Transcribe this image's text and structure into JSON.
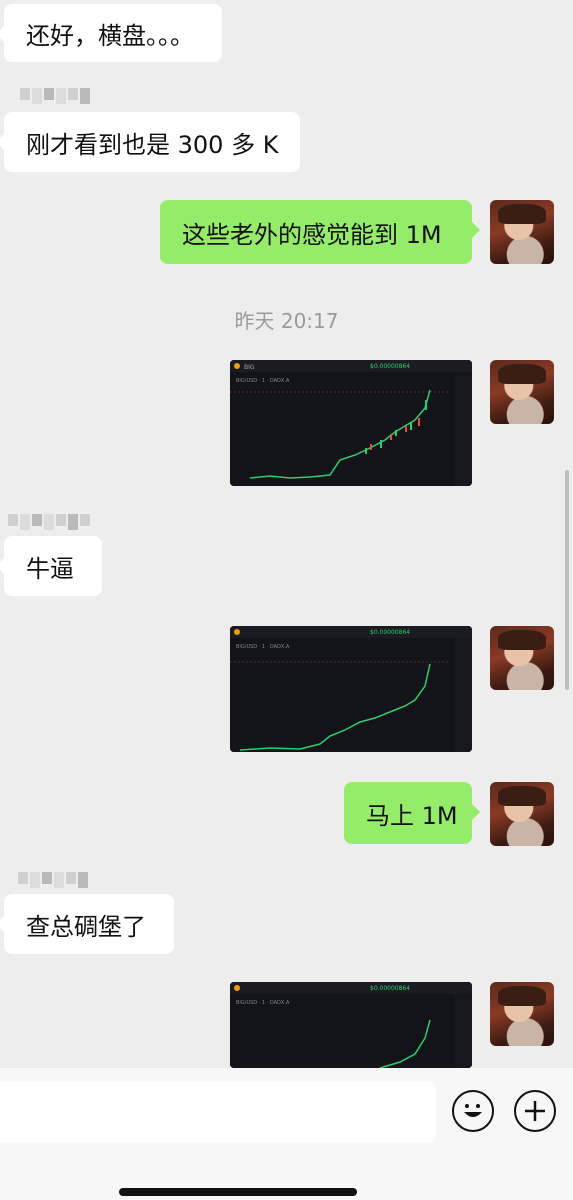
{
  "messages": [
    {
      "direction": "in",
      "text": "还好，横盘。。。"
    },
    {
      "direction": "in",
      "text": "刚才看到也是 300 多 K"
    },
    {
      "direction": "out",
      "text": "这些老外的感觉能到 1M"
    },
    {
      "direction": "out",
      "type": "image",
      "alt": "crypto price chart screenshot"
    },
    {
      "direction": "in",
      "text": "牛逼"
    },
    {
      "direction": "out",
      "type": "image",
      "alt": "crypto price chart screenshot"
    },
    {
      "direction": "out",
      "text": "马上 1M"
    },
    {
      "direction": "in",
      "text": "查总碉堡了"
    },
    {
      "direction": "out",
      "type": "image",
      "alt": "crypto price chart screenshot"
    }
  ],
  "timestamp": "昨天 20:17",
  "chart_thumb": {
    "price_label": "$0.00000864",
    "pair_label": "BIG/USD · 1 · DADX.A"
  },
  "input": {
    "placeholder": ""
  },
  "icons": {
    "emoji": "emoji-icon",
    "plus": "plus-icon"
  }
}
